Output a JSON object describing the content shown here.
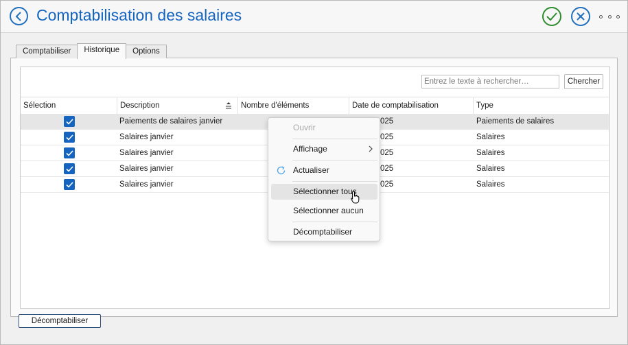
{
  "window": {
    "title": "Comptabilisation des salaires"
  },
  "tabs": [
    {
      "label": "Comptabiliser",
      "active": false
    },
    {
      "label": "Historique",
      "active": true
    },
    {
      "label": "Options",
      "active": false
    }
  ],
  "search": {
    "placeholder": "Entrez le texte à rechercher…",
    "button_label": "Chercher"
  },
  "table": {
    "columns": [
      "Sélection",
      "Description",
      "Nombre d'éléments",
      "Date de comptabilisation",
      "Type"
    ],
    "sorted_column": "Description",
    "rows": [
      {
        "selected": true,
        "description": "Paiements de salaires janvier",
        "count": "",
        "date": "025",
        "type": "Paiements de salaires"
      },
      {
        "selected": true,
        "description": "Salaires janvier",
        "count": "",
        "date": "025",
        "type": "Salaires"
      },
      {
        "selected": true,
        "description": "Salaires janvier",
        "count": "",
        "date": "025",
        "type": "Salaires"
      },
      {
        "selected": true,
        "description": "Salaires janvier",
        "count": "",
        "date": "025",
        "type": "Salaires"
      },
      {
        "selected": true,
        "description": "Salaires janvier",
        "count": "",
        "date": "025",
        "type": "Salaires"
      }
    ]
  },
  "context_menu": {
    "items": [
      {
        "label": "Ouvrir",
        "enabled": false
      },
      {
        "label": "Affichage",
        "enabled": true,
        "submenu": true
      },
      {
        "label": "Actualiser",
        "enabled": true,
        "icon": "refresh-icon"
      },
      {
        "label": "Sélectionner tous",
        "enabled": true,
        "hovered": true
      },
      {
        "label": "Sélectionner aucun",
        "enabled": true
      },
      {
        "label": "Décomptabiliser",
        "enabled": true
      }
    ]
  },
  "footer": {
    "button_label": "Décomptabiliser"
  },
  "colors": {
    "accent": "#1565c0",
    "ok": "#2e8b2e",
    "selected_row": "#e6e6e6"
  }
}
